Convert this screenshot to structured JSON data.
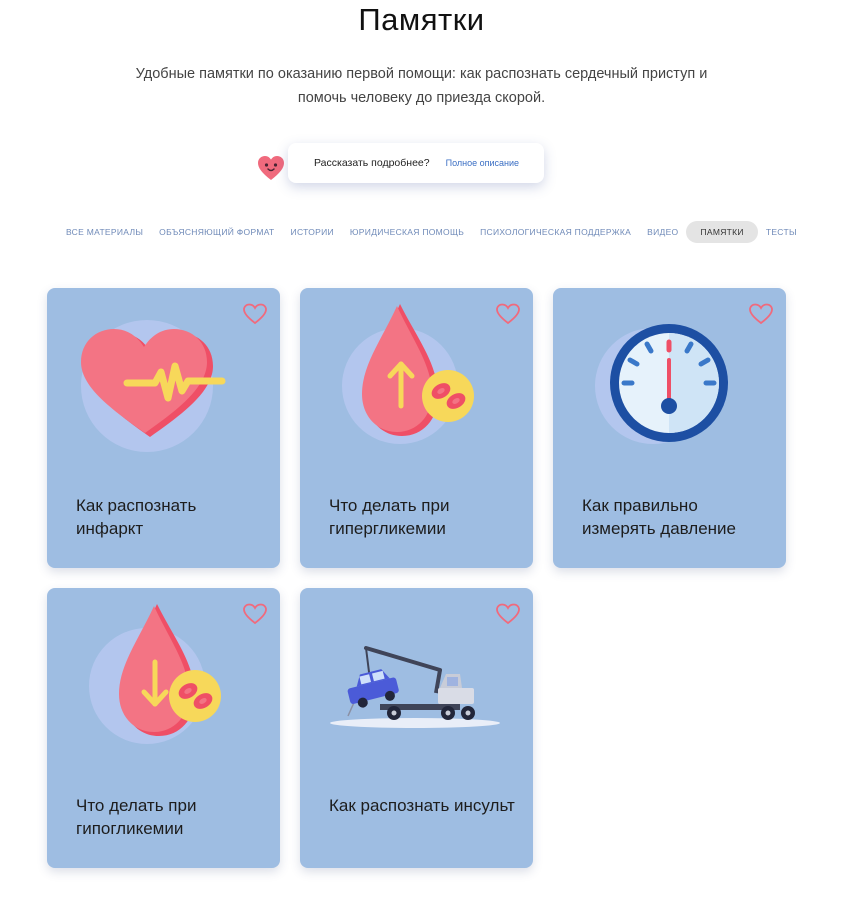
{
  "page": {
    "title": "Памятки",
    "subtitle": "Удобные памятки по оказанию первой помощи: как распознать сердечный приступ и помочь человеку до приезда скорой."
  },
  "info": {
    "question": "Рассказать подробнее?",
    "link": "Полное описание",
    "icon": "heart-face-icon"
  },
  "filters": [
    {
      "label": "ВСЕ МАТЕРИАЛЫ",
      "active": false
    },
    {
      "label": "ОБЪЯСНЯЮЩИЙ ФОРМАТ",
      "active": false
    },
    {
      "label": "ИСТОРИИ",
      "active": false
    },
    {
      "label": "ЮРИДИЧЕСКАЯ ПОМОЩЬ",
      "active": false
    },
    {
      "label": "ПСИХОЛОГИЧЕСКАЯ ПОДДЕРЖКА",
      "active": false
    },
    {
      "label": "ВИДЕО",
      "active": false
    },
    {
      "label": "ПАМЯТКИ",
      "active": true
    },
    {
      "label": "ТЕСТЫ",
      "active": false
    }
  ],
  "cards": [
    {
      "title": "Как распознать инфаркт",
      "icon": "heart-pulse-icon"
    },
    {
      "title": "Что делать при гипергликемии",
      "icon": "blood-drop-up-icon"
    },
    {
      "title": "Как правильно измерять давление",
      "icon": "pressure-gauge-icon"
    },
    {
      "title": "Что делать при гипогликемии",
      "icon": "blood-drop-down-icon"
    },
    {
      "title": "Как распознать инсульт",
      "icon": "tow-truck-icon"
    }
  ],
  "colors": {
    "card_bg": "#9ebde2",
    "accent_red": "#f2707e",
    "accent_yellow": "#f7d85a",
    "link_blue": "#3b6fc4"
  }
}
